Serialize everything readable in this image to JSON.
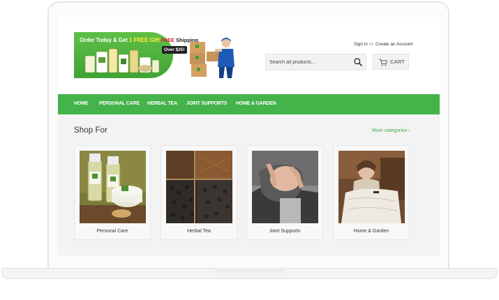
{
  "banner": {
    "text_prefix": "Order Today & Get ",
    "text_gift": "1 FREE Gift!",
    "free_prefix": "FREE ",
    "free_suffix": "Shipping",
    "over": "Over $25!"
  },
  "header": {
    "sign_in": "Sign in",
    "or": "or",
    "create_account": "Create an Account",
    "search_placeholder": "Search all products...",
    "cart_label": "CART"
  },
  "nav": {
    "items": [
      "HOME",
      "PERSONAL CARE",
      "HERBAL TEA",
      "JOINT SUPPORTS",
      "HOME & GARDEN"
    ]
  },
  "section": {
    "title": "Shop For",
    "more_link": "More categories ›"
  },
  "categories": [
    {
      "label": "Personal Care"
    },
    {
      "label": "Herbal Tea"
    },
    {
      "label": "Joint Supports"
    },
    {
      "label": "Home & Garden"
    }
  ],
  "colors": {
    "brand_green": "#44b34a",
    "link_green": "#44a64a",
    "banner_red": "#d0202a"
  }
}
